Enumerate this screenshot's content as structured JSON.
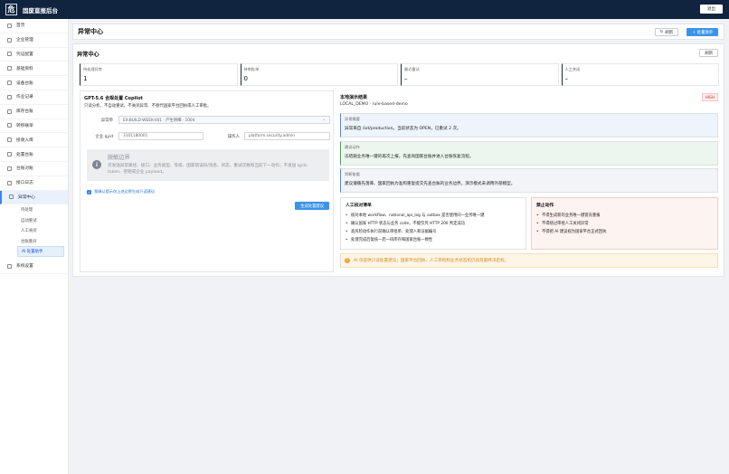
{
  "app": {
    "logo_char": "危",
    "title": "固废直报后台",
    "logout_label": "退出"
  },
  "sidebar": {
    "items": [
      {
        "label": "首页",
        "icon": "home-icon"
      },
      {
        "label": "企业管理",
        "icon": "building-icon"
      },
      {
        "label": "凭证配置",
        "icon": "key-icon"
      },
      {
        "label": "基础资料",
        "icon": "database-icon"
      },
      {
        "label": "设备台账",
        "icon": "device-icon"
      },
      {
        "label": "作业记录",
        "icon": "clipboard-icon"
      },
      {
        "label": "库存台账",
        "icon": "box-icon"
      },
      {
        "label": "转移联单",
        "icon": "transfer-icon"
      },
      {
        "label": "接收入库",
        "icon": "inbox-icon"
      },
      {
        "label": "处置台账",
        "icon": "recycle-icon"
      },
      {
        "label": "台账对账",
        "icon": "compare-icon"
      },
      {
        "label": "接口日志",
        "icon": "log-icon"
      },
      {
        "label": "异常中心",
        "icon": "alert-icon"
      }
    ],
    "sub_items": [
      "待处理",
      "自动重试",
      "人工关闭",
      "台账重开",
      "AI 处置助手"
    ],
    "settings_label": "系统设置"
  },
  "header": {
    "title": "异常中心",
    "refresh_label": "刷新",
    "new_label": "＋ 批量清单"
  },
  "main": {
    "section_title": "异常中心",
    "refresh_label": "刷新",
    "stats": [
      {
        "label": "待处理异常",
        "value": "1"
      },
      {
        "label": "待审批单",
        "value": "0"
      },
      {
        "label": "最近重试",
        "value": "–"
      },
      {
        "label": "人工关闭",
        "value": "–"
      }
    ]
  },
  "copilot": {
    "title": "GPT-5.6 合规处置 Copilot",
    "desc": "只读分析，不自动重试、不关闭异常、不替代国家平台回执或人工审批。",
    "exception_label": "异常单",
    "exception_value": "EX-BUILD-WEEK-001 · 产生明细 · 1004",
    "company_label": "企业 qyid",
    "company_value": "3101180001",
    "operator_label": "操作人",
    "operator_value": "platform.security.admin",
    "boundary_title": "脱敏边界",
    "boundary_text": "仅发送异常路径、接口、业务类型、等级、国家错误码/消息、状态、重试次数和当前下一动作；不发送 qyid、token、密钥或企业 payload。",
    "checkbox_label": "我确认提示仅上述边界生成只读建议",
    "submit_label": "生成处置建议"
  },
  "demo": {
    "title": "本地演示结果",
    "subtitle": "LOCAL_DEMO · rule-based-demo",
    "badge": "HIGH",
    "summary_label": "异常摘要",
    "summary_text": "异常来自 /iot/production。当前状态为 OPEN，已重试 2 次。",
    "suggest_label": "建议动作",
    "suggest_text": "冻结跟业务唯一键的再次上报，先查询国家台账并进入台账恢复流程。",
    "judge_label": "判断依据",
    "judge_text": "建议遵循先落库、国家回执为准和重复提交先查台账的业务边界。演示模式未调用外部模型。",
    "checklist_title": "人工核对清单",
    "checklist": [
      "核对本地 workflow、national_api_log 与 outbox 是否使用同一业务唯一键",
      "确认国家 HTTP 状态与业务 code，不能仅凭 HTTP 200 判定成功",
      "高风险动作执行前确认审批单、处理人和证据编号",
      "处理完成后复核一后一码库存和国家台账一致性"
    ],
    "forbid_title": "禁止动作",
    "forbid": [
      "不得生成新的业务唯一键冒充重报",
      "不得绕过审批人工关闭异常",
      "不得把 AI 建议视为国家平台正式回执"
    ],
    "warning": "AI 仅提供只读处置建议；国家平台回执、人工审批和业务状态机仍具有最终决定权。"
  },
  "colors": {
    "topbar": "#10233f",
    "accent": "#3b93e8",
    "warning": "#e6a23c",
    "danger": "#c0392b"
  }
}
